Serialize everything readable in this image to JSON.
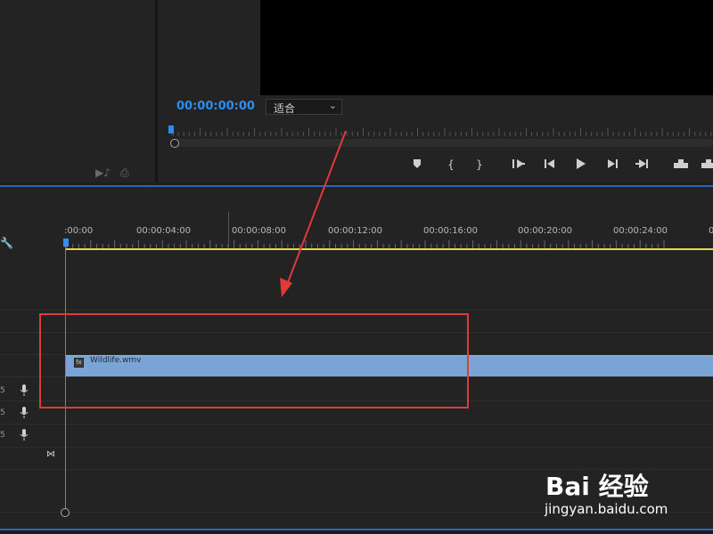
{
  "program_monitor": {
    "timecode": "00:00:00:00",
    "fit_label": "适合"
  },
  "timeline": {
    "ruler_labels": [
      ":00:00",
      "00:00:04:00",
      "00:00:08:00",
      "00:00:12:00",
      "00:00:16:00",
      "00:00:20:00",
      "00:00:24:00",
      "0"
    ],
    "clip_name": "Wildlife.wmv",
    "track_numbers": [
      "5",
      "5",
      "5"
    ]
  },
  "watermark": {
    "logo_text": "Bai 经验",
    "url": "jingyan.baidu.com"
  },
  "colors": {
    "accent_blue": "#2f8df0",
    "clip_blue": "#7aa3d6",
    "ruler_yellow": "#e6d84b",
    "annotation_red": "#e03a3a"
  }
}
